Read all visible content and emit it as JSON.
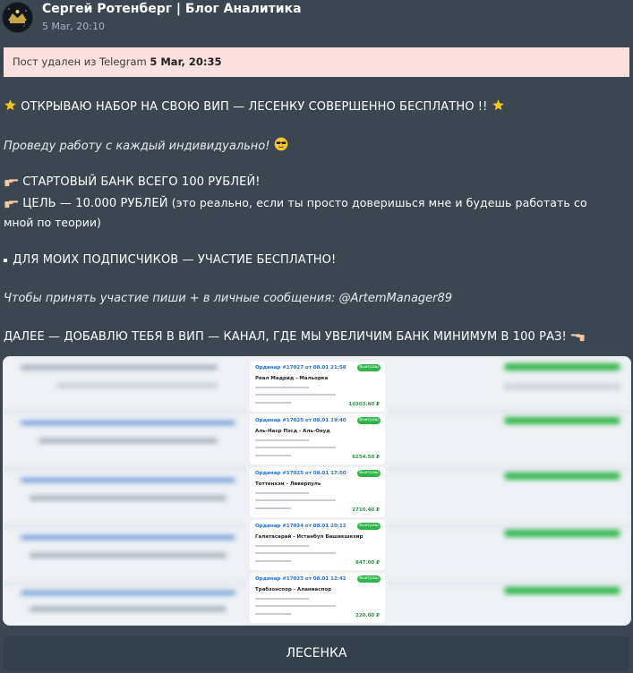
{
  "header": {
    "channel_name": "Сергей Ротенберг | Блог Аналитика",
    "time": "5 Mar, 20:10"
  },
  "banner": {
    "text": "Пост удален из Telegram",
    "date": "5 Mar, 20:35"
  },
  "post": {
    "line1": "ОТКРЫВАЮ НАБОР НА СВОЮ ВИП — ЛЕСЕНКУ СОВЕРШЕННО БЕСПЛАТНО !!",
    "line2": "Проведу работу с каждый индивидуально!",
    "line3": "СТАРТОВЫЙ БАНК ВСЕГО 100 РУБЛЕЙ!",
    "line4a": "ЦЕЛЬ — 10.000 РУБЛЕЙ",
    "line4b": "(это реально, если ты просто довеpишься мне и будешь работать со",
    "line4c": "мной по теории)",
    "line5": "ДЛЯ МОИХ ПОДПИСЧИКОВ — УЧАСТИЕ БЕСПЛАТНО!",
    "line6": "Чтобы принять участие пиши + в личные сообщения: @ArtemManager89",
    "line7": "ДАЛЕЕ — ДОБАВЛЮ ТЕБЯ В ВИП — КАНАЛ, ГДЕ МЫ УВЕЛИЧИМ БАНК МИНИМУМ В 100 РАЗ!"
  },
  "screenshot": {
    "cards": [
      {
        "order": "Ординар #17027 от 08.01 21:58",
        "badge": "Выиграш",
        "match": "Реал Мадрид - Мальорка",
        "sum": "10303.80 ₽"
      },
      {
        "order": "Ординар #17025 от 08.01 19:40",
        "badge": "Выиграш",
        "match": "Аль-Наср Пэсд - Аль-Онуд",
        "sum": "6254.50 ₽"
      },
      {
        "order": "Ординар #17025 от 08.01 17:50",
        "badge": "Выиграш",
        "match": "Тоттенхэм - Ливерпуль",
        "sum": "2710.40 ₽"
      },
      {
        "order": "Ординар #17024 от 08.01 20:12",
        "badge": "Выиграш",
        "match": "Галатасарай - Истанбул Башакшехир",
        "sum": "847.00 ₽"
      },
      {
        "order": "Ординар #17023 от 08.01 12:42",
        "badge": "Выиграш",
        "match": "Трабзонспор - Аланиаспор",
        "sum": "220.00 ₽"
      }
    ]
  },
  "button": {
    "label": "ЛЕСЕНКА"
  },
  "icons": {
    "star": "star-icon",
    "sunglasses": "sunglasses-emoji-icon",
    "pointing_hand": "pointing-hand-icon",
    "bullet": "small-square-icon"
  },
  "colors": {
    "background": "#3b4651",
    "banner": "#fbe0e0",
    "button": "#34404b",
    "accent_green": "#2fb54b"
  }
}
